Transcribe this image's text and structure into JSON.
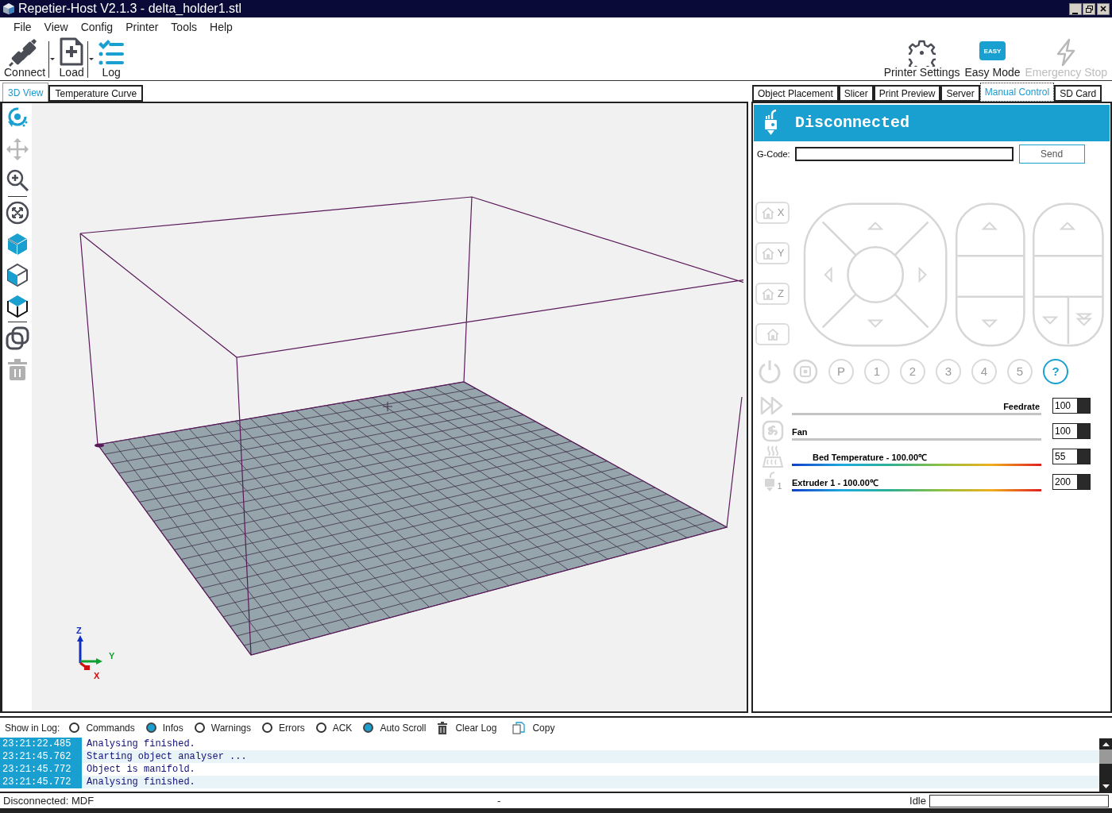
{
  "window": {
    "title": "Repetier-Host V2.1.3 - delta_holder1.stl"
  },
  "menu": [
    "File",
    "View",
    "Config",
    "Printer",
    "Tools",
    "Help"
  ],
  "toolbar": {
    "left": [
      {
        "kind": "connect",
        "label": "Connect",
        "dropdown": true
      },
      {
        "kind": "load",
        "label": "Load",
        "dropdown": true
      },
      {
        "kind": "log",
        "label": "Log",
        "dropdown": false
      }
    ],
    "right": [
      {
        "kind": "settings",
        "label": "Printer Settings",
        "disabled": false
      },
      {
        "kind": "easy",
        "label": "Easy Mode",
        "badge": "EASY",
        "disabled": false
      },
      {
        "kind": "stop",
        "label": "Emergency Stop",
        "disabled": true
      }
    ]
  },
  "view_tabs": [
    {
      "label": "3D View",
      "selected": true
    },
    {
      "label": "Temperature Curve",
      "selected": false
    }
  ],
  "viewport": {
    "axes": [
      "Z",
      "Y",
      "X"
    ]
  },
  "panel_tabs": [
    {
      "label": "Object Placement",
      "selected": false
    },
    {
      "label": "Slicer",
      "selected": false
    },
    {
      "label": "Print Preview",
      "selected": false
    },
    {
      "label": "Server",
      "selected": false
    },
    {
      "label": "Manual Control",
      "selected": true
    },
    {
      "label": "SD Card",
      "selected": false
    }
  ],
  "connection": {
    "status": "Disconnected"
  },
  "gcode": {
    "label": "G-Code:",
    "button": "Send"
  },
  "home_buttons": [
    {
      "label": "X",
      "disabled": true
    },
    {
      "label": "Y",
      "disabled": true
    },
    {
      "label": "Z",
      "disabled": true
    }
  ],
  "function_buttons": [
    {
      "label": "P",
      "disabled": true
    },
    {
      "label": "1",
      "disabled": true
    },
    {
      "label": "2",
      "disabled": true
    },
    {
      "label": "3",
      "disabled": true
    },
    {
      "label": "4",
      "disabled": true
    },
    {
      "label": "5",
      "disabled": true
    },
    {
      "label": "?",
      "disabled": false
    }
  ],
  "sliders": [
    {
      "kind": "feedrate",
      "label": "Feedrate",
      "value": "100"
    },
    {
      "kind": "fan",
      "label": "Fan",
      "value": "100"
    },
    {
      "kind": "bed",
      "label": "Bed Temperature - 100.00℃",
      "value": "55"
    },
    {
      "kind": "extruder",
      "label": "Extruder 1 - 100.00℃",
      "icon_label": "1",
      "value": "200"
    }
  ],
  "log": {
    "show_label": "Show in Log:",
    "filters": [
      {
        "label": "Commands",
        "checked": false
      },
      {
        "label": "Infos",
        "checked": true
      },
      {
        "label": "Warnings",
        "checked": false
      },
      {
        "label": "Errors",
        "checked": false
      },
      {
        "label": "ACK",
        "checked": false
      },
      {
        "label": "Auto Scroll",
        "checked": true
      }
    ],
    "actions": [
      {
        "kind": "clear",
        "label": "Clear Log"
      },
      {
        "kind": "copy",
        "label": "Copy"
      }
    ],
    "rows": [
      {
        "time": "23:21:22.485",
        "message": "Analysing finished."
      },
      {
        "time": "23:21:45.762",
        "message": "Starting object analyser ..."
      },
      {
        "time": "23:21:45.772",
        "message": "Object is manifold."
      },
      {
        "time": "23:21:45.772",
        "message": "Analysing finished."
      }
    ]
  },
  "status_bar": {
    "connection": "Disconnected: MDF",
    "middle": "-",
    "state": "Idle"
  }
}
